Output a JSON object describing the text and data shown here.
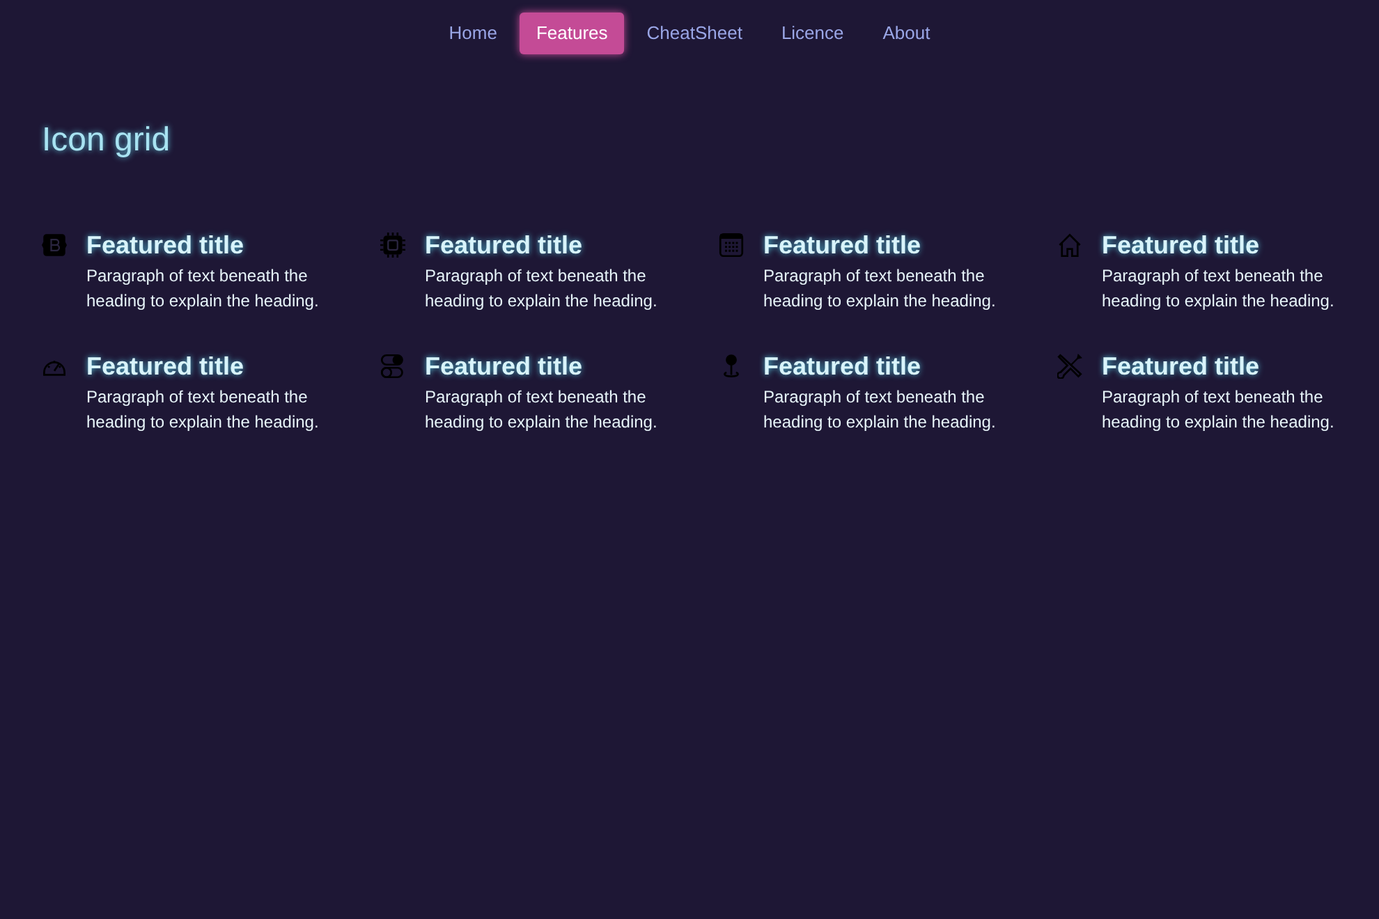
{
  "nav": [
    {
      "label": "Home",
      "selected": false
    },
    {
      "label": "Features",
      "selected": true
    },
    {
      "label": "CheatSheet",
      "selected": false
    },
    {
      "label": "Licence",
      "selected": false
    },
    {
      "label": "About",
      "selected": false
    }
  ],
  "heading": "Icon grid",
  "features": [
    {
      "kind": "bootstrap",
      "title": "Featured title",
      "text": "Paragraph of text beneath the heading to explain the heading."
    },
    {
      "kind": "cpu",
      "title": "Featured title",
      "text": "Paragraph of text beneath the heading to explain the heading."
    },
    {
      "kind": "calendar",
      "title": "Featured title",
      "text": "Paragraph of text beneath the heading to explain the heading."
    },
    {
      "kind": "house",
      "title": "Featured title",
      "text": "Paragraph of text beneath the heading to explain the heading."
    },
    {
      "kind": "speedometer",
      "title": "Featured title",
      "text": "Paragraph of text beneath the heading to explain the heading."
    },
    {
      "kind": "toggles",
      "title": "Featured title",
      "text": "Paragraph of text beneath the heading to explain the heading."
    },
    {
      "kind": "pin",
      "title": "Featured title",
      "text": "Paragraph of text beneath the heading to explain the heading."
    },
    {
      "kind": "tools",
      "title": "Featured title",
      "text": "Paragraph of text beneath the heading to explain the heading."
    }
  ]
}
